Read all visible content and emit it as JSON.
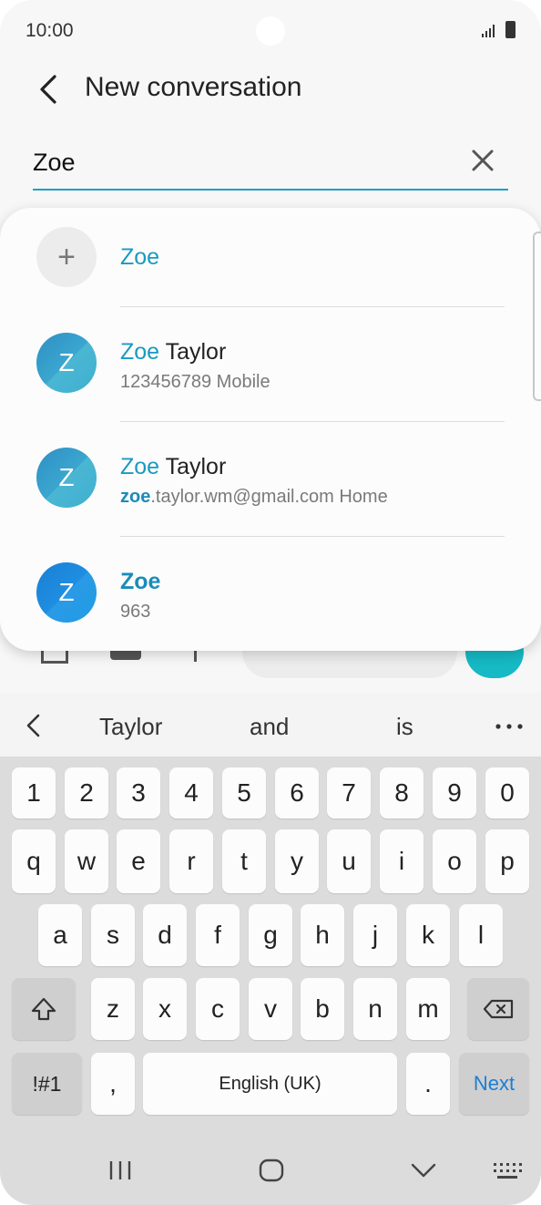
{
  "status": {
    "time": "10:00"
  },
  "header": {
    "title": "New conversation"
  },
  "search": {
    "value": "Zoe"
  },
  "dropdown": {
    "new_entry": {
      "label": "Zoe"
    },
    "contacts": [
      {
        "initial": "Z",
        "name_match": "Zoe",
        "name_rest": " Taylor",
        "detail_match": "",
        "detail_rest": "123456789  Mobile"
      },
      {
        "initial": "Z",
        "name_match": "Zoe",
        "name_rest": " Taylor",
        "detail_match": "zoe",
        "detail_rest": ".taylor.wm@gmail.com  Home"
      },
      {
        "initial": "Z",
        "name_match": "Zoe",
        "name_rest": "",
        "detail_match": "",
        "detail_rest": "963"
      }
    ]
  },
  "keyboard": {
    "suggestions": [
      "Taylor",
      "and",
      "is"
    ],
    "row_numbers": [
      "1",
      "2",
      "3",
      "4",
      "5",
      "6",
      "7",
      "8",
      "9",
      "0"
    ],
    "row1": [
      "q",
      "w",
      "e",
      "r",
      "t",
      "y",
      "u",
      "i",
      "o",
      "p"
    ],
    "row2": [
      "a",
      "s",
      "d",
      "f",
      "g",
      "h",
      "j",
      "k",
      "l"
    ],
    "row3": [
      "z",
      "x",
      "c",
      "v",
      "b",
      "n",
      "m"
    ],
    "symbols_label": "!#1",
    "comma": ",",
    "space_label": "English (UK)",
    "period": ".",
    "action_label": "Next"
  },
  "colors": {
    "accent": "#1aa0c6",
    "send": "#16b9c4",
    "action": "#1a7fd5"
  }
}
